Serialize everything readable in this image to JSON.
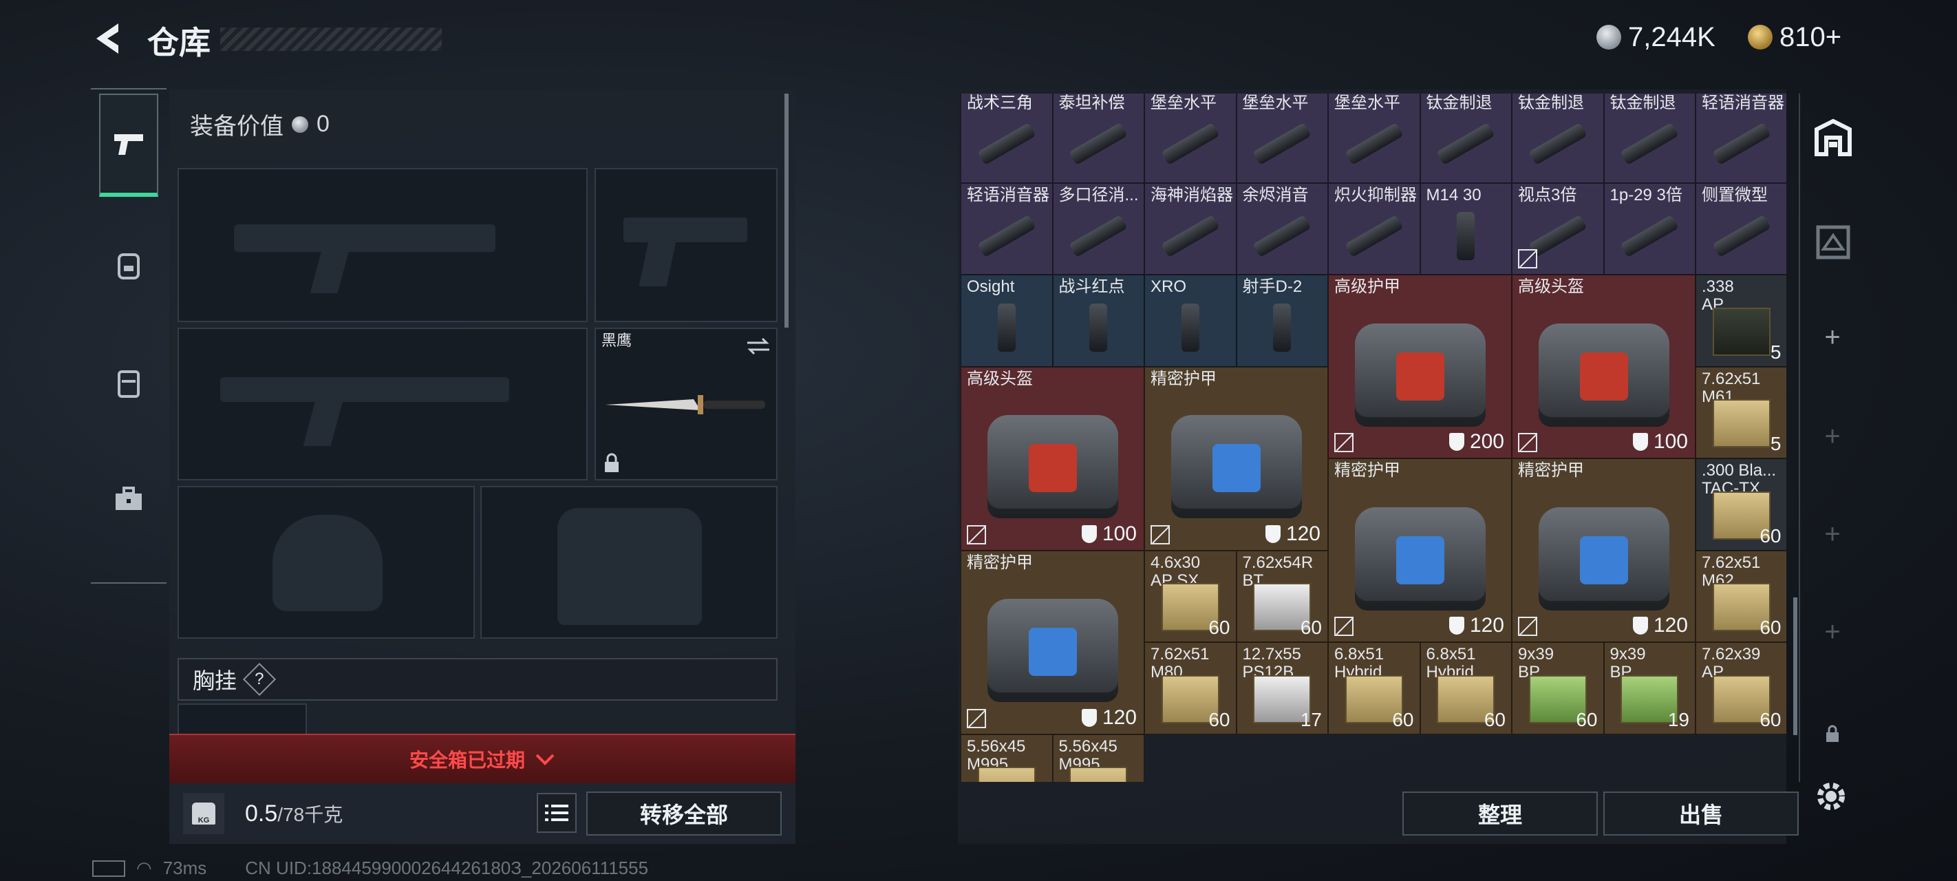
{
  "header": {
    "title": "仓库",
    "currency_silver": "7,244K",
    "currency_gold": "810+"
  },
  "left_tabs": [
    "weapon-tab",
    "bag-tab",
    "armor-tab",
    "toolbox-tab"
  ],
  "equipment": {
    "value_label": "装备价值",
    "value": "0",
    "knife_name": "黑鹰",
    "chest_rig_label": "胸挂",
    "chest_rig_help": "?",
    "safe_box_expired": "安全箱已过期",
    "capacity_value": "0.5",
    "capacity_total": "/78千克",
    "weight_icon_text": "KG",
    "transfer_all": "转移全部"
  },
  "inventory": {
    "row1": [
      "战术三角",
      "泰坦补偿",
      "堡垒水平",
      "堡垒水平",
      "堡垒水平",
      "钛金制退",
      "钛金制退",
      "钛金制退",
      "轻语消音器"
    ],
    "row2": [
      "轻语消音器",
      "多口径消...",
      "海神消焰器",
      "余烬消音",
      "炽火抑制器",
      "M14 30",
      "视点3倍",
      "1p-29 3倍",
      "侧置微型"
    ],
    "row3_small": [
      "Osight",
      "战斗红点",
      "XRO",
      "射手D-2"
    ],
    "big_items": [
      {
        "name": "高级护甲",
        "durability": "200"
      },
      {
        "name": "高级头盔",
        "durability": "100"
      },
      {
        "name": "高级头盔",
        "durability": "100"
      },
      {
        "name": "精密护甲",
        "durability": "120"
      },
      {
        "name": "精密护甲",
        "durability": "120"
      },
      {
        "name": "精密护甲",
        "durability": "120"
      },
      {
        "name": "精密护甲",
        "durability": "120"
      }
    ],
    "ammo_right": [
      {
        "name": ".338\nAP",
        "qty": "5"
      },
      {
        "name": "7.62x51\nM61",
        "qty": "5"
      },
      {
        "name": ".300 Bla...\nTAC-TX",
        "qty": "60"
      },
      {
        "name": "7.62x51\nM62",
        "qty": "60"
      }
    ],
    "ammo_row5": [
      {
        "name": "4.6x30\nAP SX",
        "qty": "60"
      },
      {
        "name": "7.62x54R\nBT",
        "qty": "60"
      }
    ],
    "ammo_row6": [
      {
        "name": "7.62x51\nM80",
        "qty": "60"
      },
      {
        "name": "12.7x55\nPS12B",
        "qty": "17"
      },
      {
        "name": "6.8x51\nHybrid",
        "qty": "60"
      },
      {
        "name": "6.8x51\nHybrid",
        "qty": "60"
      },
      {
        "name": "9x39\nBP",
        "qty": "60"
      },
      {
        "name": "9x39\nBP",
        "qty": "19"
      },
      {
        "name": "7.62x39\nAP",
        "qty": "60"
      }
    ],
    "ammo_row7": [
      {
        "name": "5.56x45\nM995"
      },
      {
        "name": "5.56x45\nM995"
      }
    ],
    "sort_button": "整理",
    "sell_button": "出售"
  },
  "footer": {
    "ping": "73ms",
    "uid": "CN UID:18844599000264426180З_202606111555"
  }
}
